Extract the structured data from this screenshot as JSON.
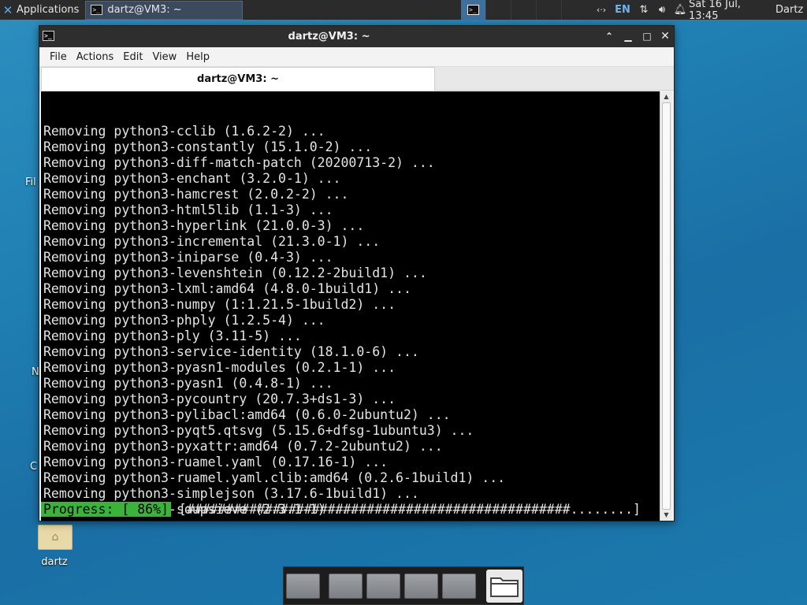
{
  "top_panel": {
    "apps_label": "Applications",
    "task_title": "dartz@VM3: ~",
    "language": "EN",
    "clock": "Sat 16 Jul, 13:45",
    "user": "Dartz"
  },
  "desktop": {
    "fragments": [
      "Fil",
      "N",
      "C"
    ],
    "home_label": "dartz"
  },
  "window": {
    "title": "dartz@VM3: ~",
    "menu": [
      "File",
      "Actions",
      "Edit",
      "View",
      "Help"
    ],
    "tab_title": "dartz@VM3: ~",
    "lines": [
      "Removing python3-cclib (1.6.2-2) ...",
      "Removing python3-constantly (15.1.0-2) ...",
      "Removing python3-diff-match-patch (20200713-2) ...",
      "Removing python3-enchant (3.2.0-1) ...",
      "Removing python3-hamcrest (2.0.2-2) ...",
      "Removing python3-html5lib (1.1-3) ...",
      "Removing python3-hyperlink (21.0.0-3) ...",
      "Removing python3-incremental (21.3.0-1) ...",
      "Removing python3-iniparse (0.4-3) ...",
      "Removing python3-levenshtein (0.12.2-2build1) ...",
      "Removing python3-lxml:amd64 (4.8.0-1build1) ...",
      "Removing python3-numpy (1:1.21.5-1build2) ...",
      "Removing python3-phply (1.2.5-4) ...",
      "Removing python3-ply (3.11-5) ...",
      "Removing python3-service-identity (18.1.0-6) ...",
      "Removing python3-pyasn1-modules (0.2.1-1) ...",
      "Removing python3-pyasn1 (0.4.8-1) ...",
      "Removing python3-pycountry (20.7.3+ds1-3) ...",
      "Removing python3-pylibacl:amd64 (0.6.0-2ubuntu2) ...",
      "Removing python3-pyqt5.qtsvg (5.15.6+dfsg-1ubuntu3) ...",
      "Removing python3-pyxattr:amd64 (0.7.2-2ubuntu2) ...",
      "Removing python3-ruamel.yaml (0.17.16-1) ...",
      "Removing python3-ruamel.yaml.clib:amd64 (0.2.6-1build1) ...",
      "Removing python3-simplejson (3.17.6-1build1) ...",
      "Removing python3-soupsieve (2.3.1-1) ..."
    ],
    "progress_label": "Progress: [ 86%]",
    "progress_bar": "[#################################################........]",
    "progress_fraction": 0.86
  },
  "colors": {
    "desktop": "#1f7eb2",
    "panel": "#2b2b2b",
    "terminal_bg": "#000000",
    "terminal_fg": "#e5e5e5",
    "progress_bg": "#3bb33b"
  }
}
